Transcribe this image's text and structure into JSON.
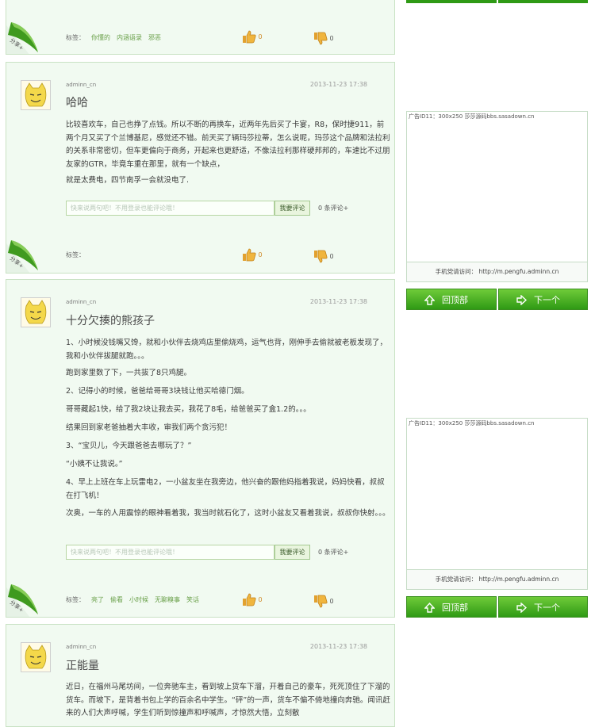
{
  "top_post": {
    "tags_label": "标签：",
    "tags": [
      "你懂的",
      "内涵语录",
      "邪恶"
    ],
    "likes": "0",
    "dislikes": "0",
    "share_label": "分享+"
  },
  "posts": [
    {
      "author": "adminn_cn",
      "date": "2013-11-23 17:38",
      "title": "哈哈",
      "paragraphs": [
        "比较喜欢车，自己也挣了点钱。所以不断的再换车，近两年先后买了卡宴，R8，保时捷911，前两个月又买了个兰博基尼，感觉还不错。前天买了辆玛莎拉蒂，怎么说呢，玛莎这个品牌和法拉利的关系非常密切，但车更偏向于商务，开起来也更舒适，不像法拉利那样硬邦邦的，车速比不过朋友家的GTR，毕竟车重在那里，就有一个缺点，",
        "就是太费电，四节南孚一会就没电了."
      ],
      "comment_placeholder": "快来说两句吧！不用登录也能评论哦！",
      "comment_button": "我要评论",
      "comment_count": "0 条评论+",
      "tags_label": "标签：",
      "tags": [],
      "likes": "0",
      "dislikes": "0",
      "share_label": "分享+"
    },
    {
      "author": "adminn_cn",
      "date": "2013-11-23 17:38",
      "title": "十分欠揍的熊孩子",
      "paragraphs": [
        "1、小时候没钱嘴又馋，就和小伙伴去烧鸡店里偷烧鸡，运气也背，刚伸手去偷就被老板发现了，我和小伙伴拔腿就跑。。。",
        "跑到家里数了下，一共拔了8只鸡腿。",
        "2、记得小的时候，爸爸给哥哥3块钱让他买哈德门烟。",
        "哥哥藏起1快，给了我2块让我去买，我花了8毛，给爸爸买了盒1.2的。。。",
        "结果回到家老爸抽着大丰收，审我们两个贪污犯！",
        "3、“宝贝儿，今天跟爸爸去哪玩了？”",
        "“小姨不让我说。”",
        "4、早上上班在车上玩雷电2，一小盆友坐在我旁边，他兴奋的跟他妈指着我说，妈妈快看，叔叔在打飞机！",
        "次奥，一车的人用震惊的眼神看着我，我当时就石化了，这时小盆友又看着我说，叔叔你快射。。。"
      ],
      "comment_placeholder": "快来说两句吧！不用登录也能评论哦！",
      "comment_button": "我要评论",
      "comment_count": "0 条评论+",
      "tags_label": "标签：",
      "tags": [
        "亮了",
        "偷看",
        "小时候",
        "无聊糗事",
        "笑话"
      ],
      "likes": "0",
      "dislikes": "0",
      "share_label": "分享+"
    },
    {
      "author": "adminn_cn",
      "date": "2013-11-23 17:38",
      "title": "正能量",
      "paragraphs": [
        "近日，在福州马尾坊间，一位奔驰车主，看到坡上货车下溜，开着自己的豪车，死死顶住了下溜的货车。而坡下，是背着书包上学的百余名中学生。“砰”的一声，货车不偏不倚地撞向奔驰。闻讯赶来的人们大声呼喊，学生们听到惊撞声和呼喊声，才惊然大悟，立刻散"
      ]
    }
  ],
  "ads": [
    {
      "label": "广告ID11：300x250 莎莎源码bbs.sasadown.cn",
      "footer": "手机党请访问： http://m.pengfu.adminn.cn"
    },
    {
      "label": "广告ID11：300x250 莎莎源码bbs.sasadown.cn",
      "footer": "手机党请访问： http://m.pengfu.adminn.cn"
    }
  ],
  "nav": {
    "top_button": "回顶部",
    "next_button": "下一个"
  },
  "colors": {
    "post_bg": "#f1faf1",
    "accent_green": "#3aa01c",
    "tag_green": "#6aa04a"
  }
}
